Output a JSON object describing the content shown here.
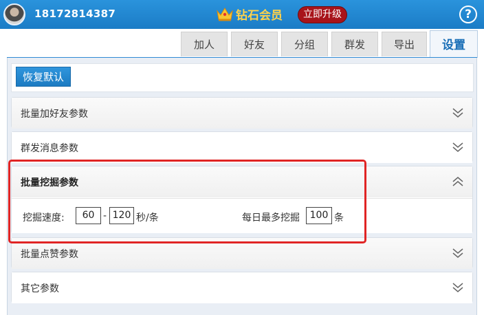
{
  "header": {
    "phone": "18172814387",
    "vip_label": "钻石会员",
    "upgrade_label": "立即升级",
    "help_label": "?"
  },
  "tabs": [
    {
      "label": "加人"
    },
    {
      "label": "好友"
    },
    {
      "label": "分组"
    },
    {
      "label": "群发"
    },
    {
      "label": "导出"
    },
    {
      "label": "设置",
      "active": true
    }
  ],
  "toolbar": {
    "restore_label": "恢复默认"
  },
  "sections": [
    {
      "title": "批量加好友参数",
      "expanded": false
    },
    {
      "title": "群发消息参数",
      "expanded": false
    },
    {
      "title": "批量挖掘参数",
      "expanded": true,
      "speed_label": "挖掘速度:",
      "speed_min": "60",
      "speed_sep": "-",
      "speed_max": "120",
      "speed_unit": "秒/条",
      "daily_label": "每日最多挖掘",
      "daily_max": "100",
      "daily_unit": "条"
    },
    {
      "title": "批量点赞参数",
      "expanded": false
    },
    {
      "title": "其它参数",
      "expanded": false
    }
  ],
  "colors": {
    "header_blue": "#1b7cc6",
    "vip_gold": "#ffd24a",
    "upgrade_red": "#a8141a",
    "highlight_red": "#e02424",
    "active_tab_text": "#1b6fb7"
  }
}
